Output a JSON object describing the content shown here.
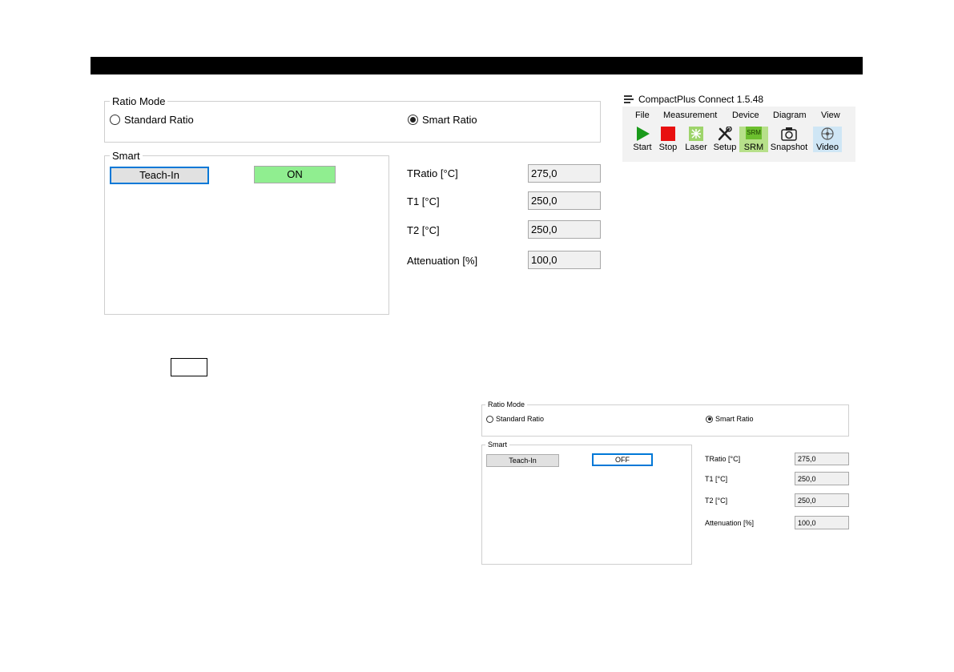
{
  "main_panel": {
    "ratio_mode_label": "Ratio Mode",
    "standard_ratio": "Standard Ratio",
    "smart_ratio": "Smart Ratio",
    "selected_mode": "Smart Ratio",
    "smart_label": "Smart",
    "teach_in": "Teach-In",
    "state": "ON",
    "fields": [
      {
        "label": "TRatio [°C]",
        "value": "275,0"
      },
      {
        "label": "T1 [°C]",
        "value": "250,0"
      },
      {
        "label": "T2 [°C]",
        "value": "250,0"
      },
      {
        "label": "Attenuation [%]",
        "value": "100,0"
      }
    ]
  },
  "secondary_panel": {
    "ratio_mode_label": "Ratio Mode",
    "standard_ratio": "Standard Ratio",
    "smart_ratio": "Smart Ratio",
    "selected_mode": "Smart Ratio",
    "smart_label": "Smart",
    "teach_in": "Teach-In",
    "state": "OFF",
    "fields": [
      {
        "label": "TRatio [°C]",
        "value": "275,0"
      },
      {
        "label": "T1 [°C]",
        "value": "250,0"
      },
      {
        "label": "T2 [°C]",
        "value": "250,0"
      },
      {
        "label": "Attenuation [%]",
        "value": "100,0"
      }
    ]
  },
  "app": {
    "title": "CompactPlus Connect 1.5.48",
    "menu": [
      "File",
      "Measurement",
      "Device",
      "Diagram",
      "View"
    ],
    "toolbar": [
      {
        "label": "Start",
        "icon": "play-icon"
      },
      {
        "label": "Stop",
        "icon": "stop-icon"
      },
      {
        "label": "Laser",
        "icon": "laser-icon"
      },
      {
        "label": "Setup",
        "icon": "tools-icon"
      },
      {
        "label": "SRM",
        "icon": "srm-icon",
        "icon_text": "SRM"
      },
      {
        "label": "Snapshot",
        "icon": "camera-icon"
      },
      {
        "label": "Video",
        "icon": "video-icon"
      }
    ]
  },
  "colors": {
    "on_green": "#90ee90",
    "focus_blue": "#0078d7",
    "play_green": "#1a9a1a",
    "stop_red": "#e81010"
  }
}
